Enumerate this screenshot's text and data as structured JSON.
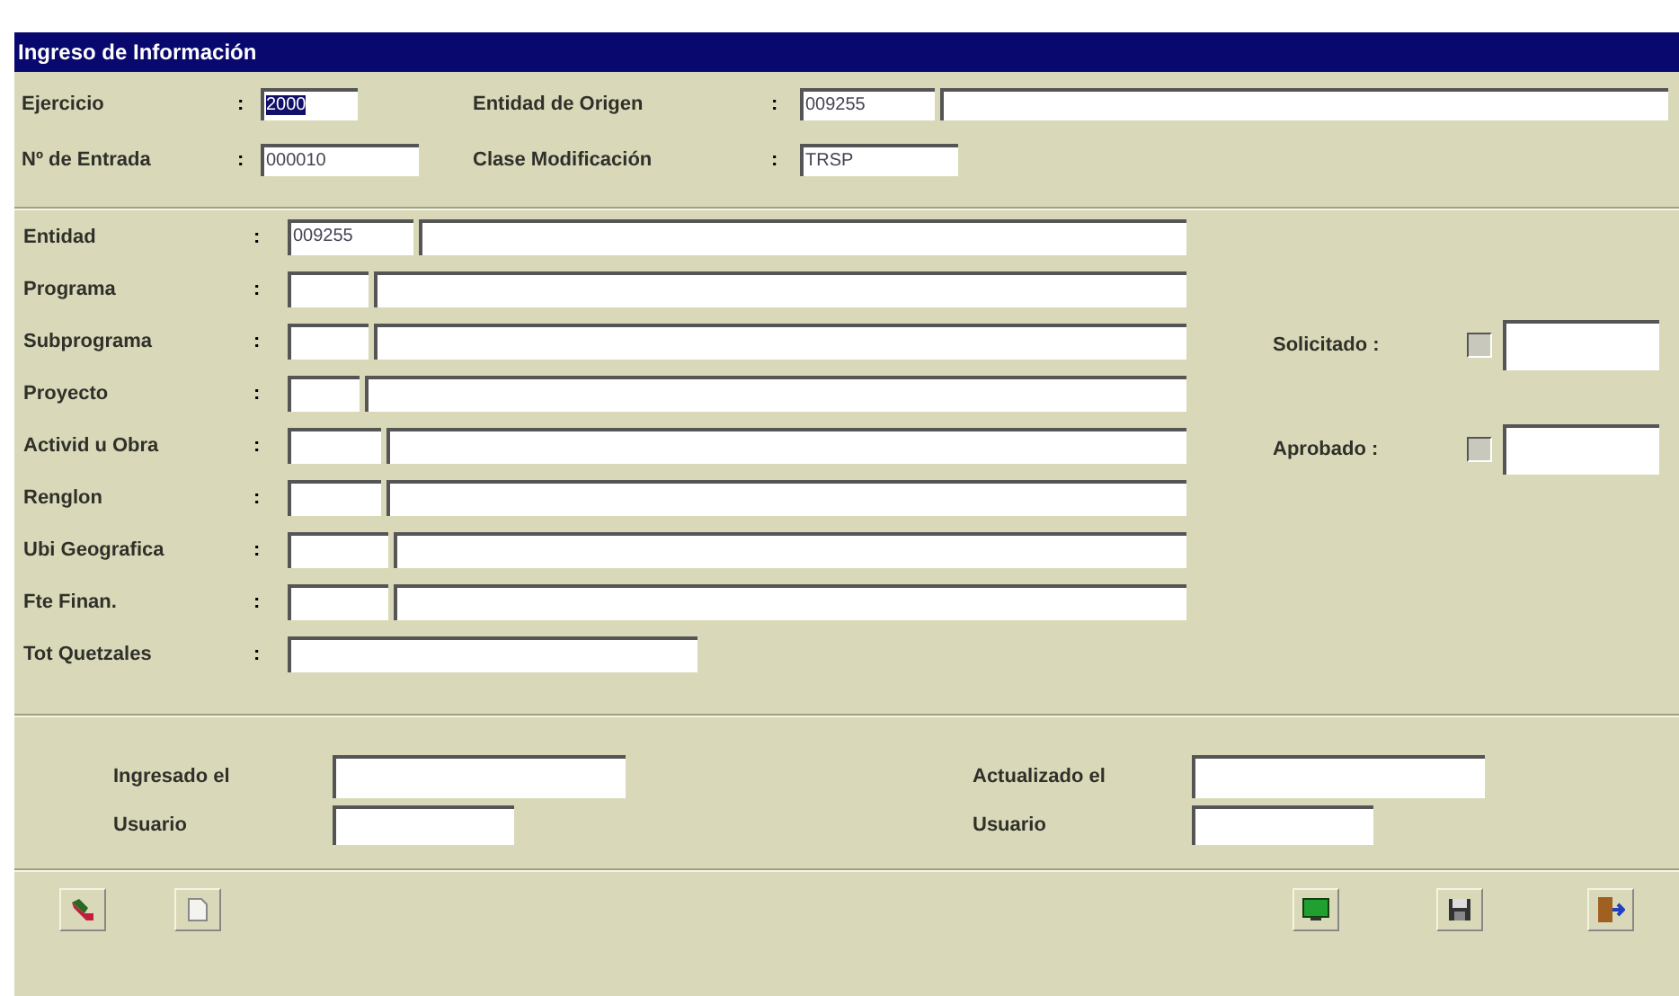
{
  "window": {
    "title": "Ingreso de Información"
  },
  "header": {
    "rows": [
      {
        "items": [
          {
            "label": "Ejercicio",
            "colon": ":",
            "fields": [
              {
                "value": "2000",
                "selected": true
              }
            ]
          },
          {
            "label": "Entidad de  Origen",
            "colon": ":",
            "fields": [
              {
                "value": "009255",
                "selected": false
              },
              {
                "selected": false
              }
            ]
          }
        ]
      },
      {
        "items": [
          {
            "label": "Nº de Entrada",
            "colon": ":",
            "fields": [
              {
                "value": "000010",
                "selected": false
              }
            ]
          },
          {
            "label": "Clase Modificación",
            "colon": ":",
            "fields": [
              {
                "value": "TRSP",
                "selected": false
              }
            ]
          }
        ]
      }
    ]
  },
  "details": {
    "rows": [
      {
        "label": "Entidad",
        "colon": ":",
        "code": "009255",
        "kind": "pair"
      },
      {
        "label": "Programa",
        "colon": ":",
        "kind": "pair"
      },
      {
        "label": "Subprograma",
        "colon": ":",
        "kind": "pair"
      },
      {
        "label": "Proyecto",
        "colon": ":",
        "kind": "pair"
      },
      {
        "label": "Activid u Obra",
        "colon": ":",
        "kind": "pair"
      },
      {
        "label": "Renglon",
        "colon": ":",
        "kind": "pair"
      },
      {
        "label": "Ubi Geografica",
        "colon": ":",
        "kind": "pair"
      },
      {
        "label": "Fte Finan.",
        "colon": ":",
        "kind": "pair"
      },
      {
        "label": "Tot Quetzales",
        "colon": ":",
        "kind": "single"
      }
    ],
    "flags": [
      {
        "label": "Solicitado :",
        "checked": false
      },
      {
        "label": "Aprobado :",
        "checked": false
      }
    ]
  },
  "audit": [
    {
      "created_label": "Ingresado el",
      "user_label": "Usuario"
    },
    {
      "created_label": "Actualizado el",
      "user_label": "Usuario"
    }
  ],
  "toolbar": [
    {
      "kind": "edit"
    },
    {
      "kind": "new"
    },
    {
      "kind": "screen"
    },
    {
      "kind": "save"
    },
    {
      "kind": "exit"
    }
  ]
}
